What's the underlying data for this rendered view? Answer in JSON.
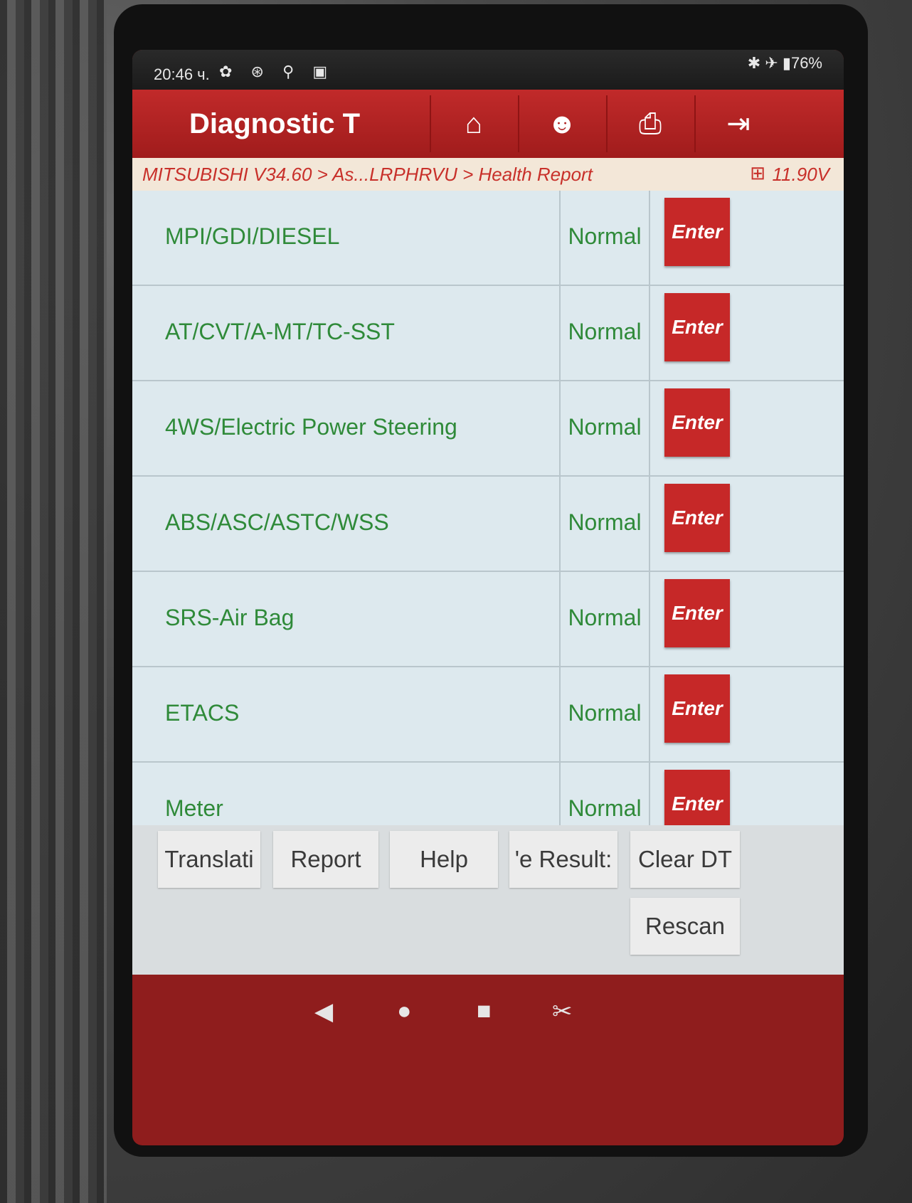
{
  "statusbar": {
    "time": "20:46 ч.",
    "icons": "✿ ⊛ ⚲ ▣",
    "right": "✱ ✈ ▮76%"
  },
  "appbar": {
    "title": "Diagnostic T",
    "buttons": [
      {
        "icon": "home-icon",
        "glyph": "⌂"
      },
      {
        "icon": "support-agent-icon",
        "glyph": "☻"
      },
      {
        "icon": "printer-icon",
        "glyph": "⎙"
      },
      {
        "icon": "exit-icon",
        "glyph": "⇥"
      }
    ]
  },
  "breadcrumb": {
    "path": "MITSUBISHI V34.60 > As...LRPHRVU > Health Report",
    "battery_glyph": "⊞",
    "voltage": "11.90V"
  },
  "systems": [
    {
      "name": "MPI/GDI/DIESEL",
      "status": "Normal",
      "action": "Enter"
    },
    {
      "name": "AT/CVT/A-MT/TC-SST",
      "status": "Normal",
      "action": "Enter"
    },
    {
      "name": "4WS/Electric Power Steering",
      "status": "Normal",
      "action": "Enter"
    },
    {
      "name": "ABS/ASC/ASTC/WSS",
      "status": "Normal",
      "action": "Enter"
    },
    {
      "name": "SRS-Air Bag",
      "status": "Normal",
      "action": "Enter"
    },
    {
      "name": "ETACS",
      "status": "Normal",
      "action": "Enter"
    },
    {
      "name": "Meter",
      "status": "Normal",
      "action": "Enter"
    }
  ],
  "toolbar": {
    "translate": "Translati",
    "report": "Report",
    "help": "Help",
    "results": "'e Result:",
    "clear": "Clear DT",
    "rescan": "Rescan"
  },
  "navbar": {
    "back": "◀",
    "home": "●",
    "recents": "■",
    "screenshot": "✂"
  },
  "colors": {
    "header_red": "#b32222",
    "button_red": "#c62828",
    "text_green": "#2f8a39",
    "list_bg": "#dde9ee"
  }
}
